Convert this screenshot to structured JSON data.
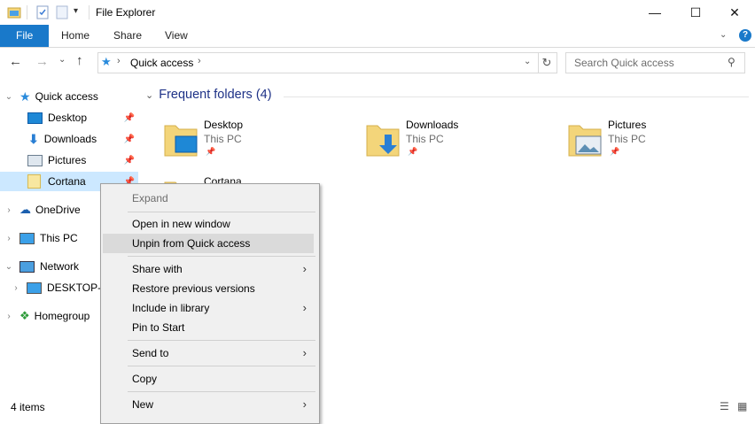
{
  "window": {
    "title": "File Explorer"
  },
  "ribbon": {
    "tabs": [
      "File",
      "Home",
      "Share",
      "View"
    ]
  },
  "address": {
    "location": "Quick access",
    "search_placeholder": "Search Quick access"
  },
  "nav": {
    "items": [
      {
        "label": "Quick access",
        "icon": "star-icon"
      },
      {
        "label": "Desktop",
        "icon": "desktop-icon"
      },
      {
        "label": "Downloads",
        "icon": "download-icon"
      },
      {
        "label": "Pictures",
        "icon": "pictures-icon"
      },
      {
        "label": "Cortana",
        "icon": "folder-icon"
      },
      {
        "label": "OneDrive",
        "icon": "cloud-icon"
      },
      {
        "label": "This PC",
        "icon": "computer-icon"
      },
      {
        "label": "Network",
        "icon": "network-icon"
      },
      {
        "label": "DESKTOP-B",
        "icon": "computer-icon"
      },
      {
        "label": "Homegroup",
        "icon": "homegroup-icon"
      }
    ]
  },
  "content": {
    "group_title": "Frequent folders (4)",
    "folders": [
      {
        "name": "Desktop",
        "location": "This PC"
      },
      {
        "name": "Downloads",
        "location": "This PC"
      },
      {
        "name": "Pictures",
        "location": "This PC"
      },
      {
        "name": "Cortana",
        "location": ""
      }
    ]
  },
  "context_menu": {
    "items": [
      {
        "label": "Expand"
      },
      {
        "label": "Open in new window"
      },
      {
        "label": "Unpin from Quick access"
      },
      {
        "label": "Share with"
      },
      {
        "label": "Restore previous versions"
      },
      {
        "label": "Include in library"
      },
      {
        "label": "Pin to Start"
      },
      {
        "label": "Send to"
      },
      {
        "label": "Copy"
      },
      {
        "label": "New"
      }
    ]
  },
  "status": {
    "items_count": "4 items"
  },
  "colors": {
    "accent": "#1979ca",
    "selection": "#cce8ff",
    "folder": "#f3d57a",
    "header_text": "#1e3287"
  }
}
